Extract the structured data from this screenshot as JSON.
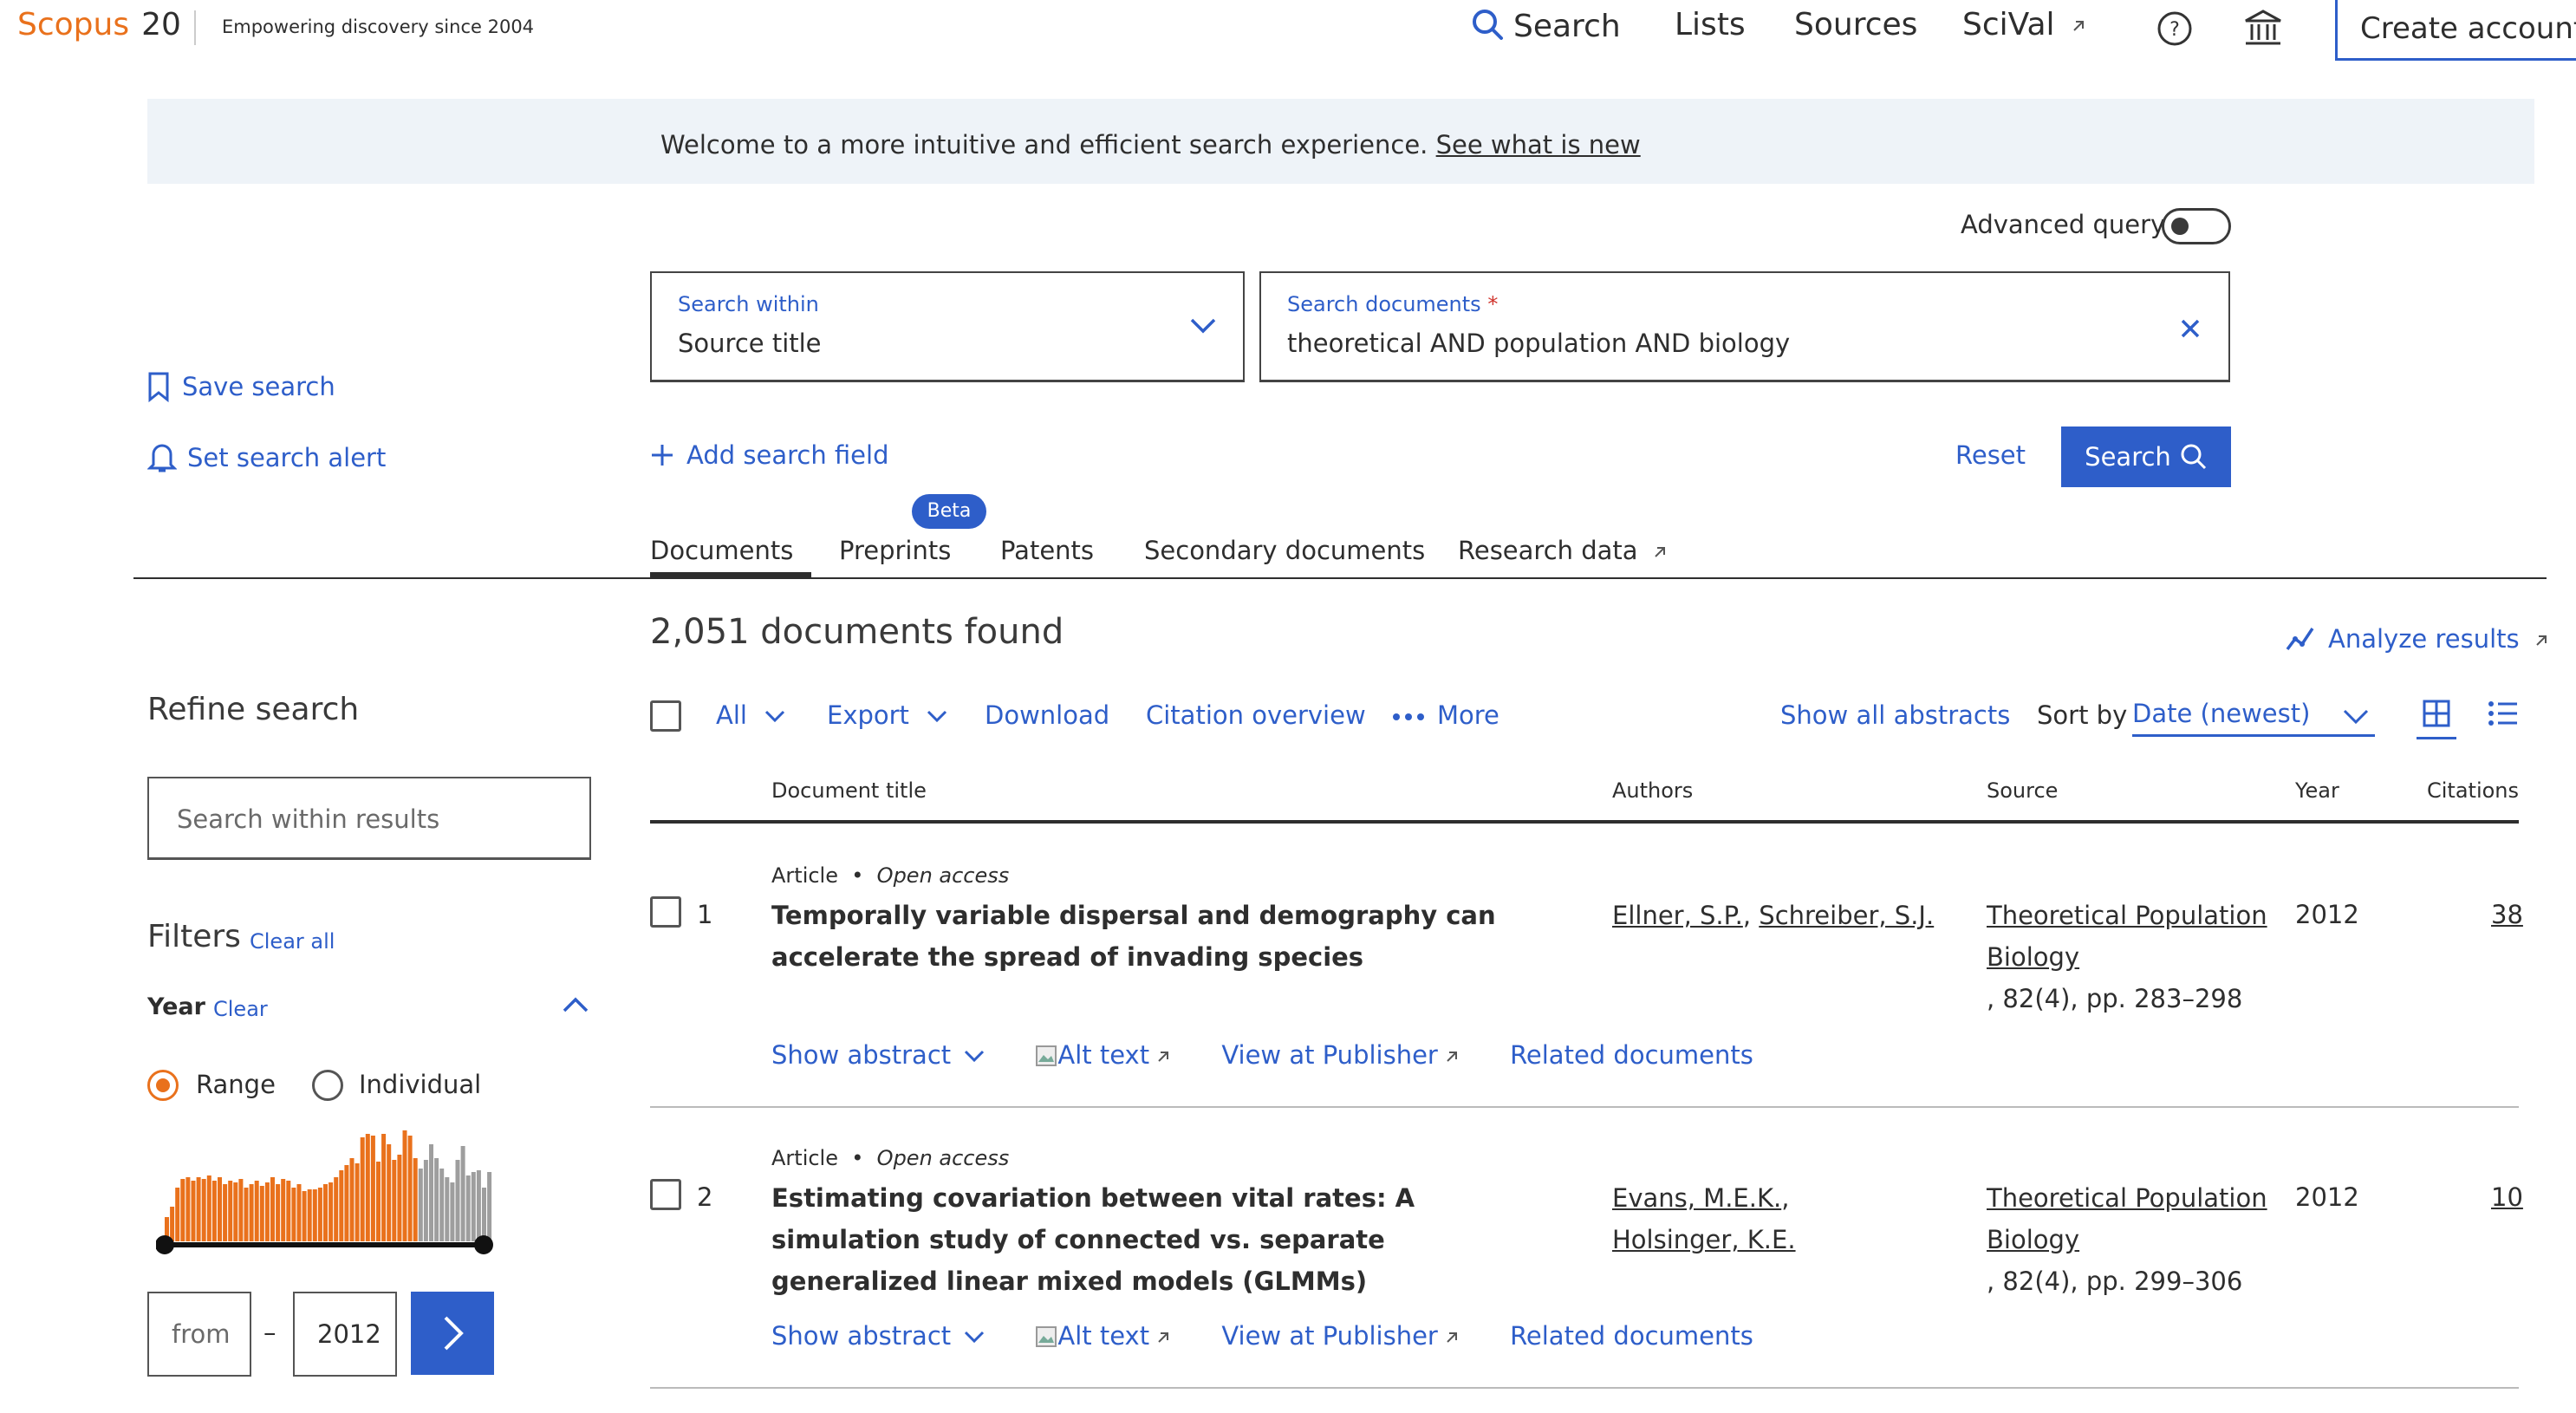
{
  "header": {
    "logo_text": "Scopus",
    "logo_number": "20",
    "tagline": "Empowering discovery since 2004",
    "nav": {
      "search": "Search",
      "lists": "Lists",
      "sources": "Sources",
      "scival": "SciVal"
    },
    "create_account": "Create account"
  },
  "banner": {
    "text": "Welcome to a more intuitive and efficient search experience.",
    "link": "See what is new"
  },
  "search": {
    "advanced_query_label": "Advanced query",
    "within_label": "Search within",
    "within_value": "Source title",
    "documents_label": "Search documents",
    "required_mark": "*",
    "documents_value": "theoretical AND population AND biology",
    "add_field": "Add search field",
    "reset": "Reset",
    "search_button": "Search"
  },
  "sidebar_actions": {
    "save_search": "Save search",
    "set_alert": "Set search alert"
  },
  "tabs": {
    "documents": "Documents",
    "preprints": "Preprints",
    "preprints_badge": "Beta",
    "patents": "Patents",
    "secondary": "Secondary documents",
    "research_data": "Research data"
  },
  "results": {
    "count_text": "2,051 documents found",
    "analyze": "Analyze results",
    "toolbar": {
      "all": "All",
      "export": "Export",
      "download": "Download",
      "citation_overview": "Citation overview",
      "more": "More",
      "show_all_abstracts": "Show all abstracts",
      "sort_by": "Sort by",
      "sort_value": "Date (newest)"
    },
    "columns": {
      "title": "Document title",
      "authors": "Authors",
      "source": "Source",
      "year": "Year",
      "citations": "Citations"
    },
    "rows": [
      {
        "num": "1",
        "doc_type": "Article",
        "access": "Open access",
        "title": "Temporally variable dispersal and demography can accelerate the spread of invading species",
        "author1": "Ellner, S.P.",
        "author2": "Schreiber, S.J.",
        "source": "Theoretical Population Biology",
        "source_detail": ", 82(4), pp. 283–298",
        "year": "2012",
        "citations": "38"
      },
      {
        "num": "2",
        "doc_type": "Article",
        "access": "Open access",
        "title": "Estimating covariation between vital rates: A simulation study of connected vs. separate generalized linear mixed models (GLMMs)",
        "author1": "Evans, M.E.K.",
        "author2": "Holsinger, K.E.",
        "source": "Theoretical Population Biology",
        "source_detail": ", 82(4), pp. 299–306",
        "year": "2012",
        "citations": "10"
      }
    ],
    "row_actions": {
      "show_abstract": "Show abstract",
      "alt_text": "Alt text",
      "view_publisher": "View at Publisher",
      "related": "Related documents"
    }
  },
  "refine": {
    "title": "Refine search",
    "search_within_placeholder": "Search within results",
    "filters": "Filters",
    "clear_all": "Clear all",
    "year_heading": "Year",
    "year_clear": "Clear",
    "range": "Range",
    "individual": "Individual",
    "from_placeholder": "from",
    "dash": "–",
    "to_value": "2012",
    "colors": {
      "selected": "#e9711c",
      "unselected": "#9e9e9e"
    }
  }
}
